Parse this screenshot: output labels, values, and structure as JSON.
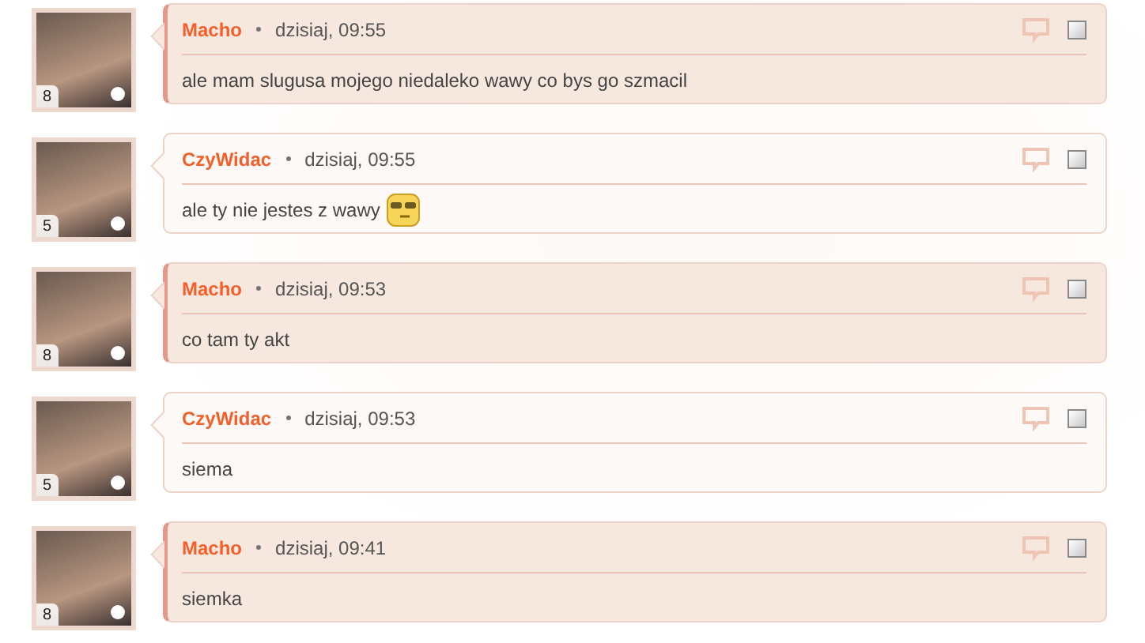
{
  "messages": [
    {
      "author": "Macho",
      "rank": "8",
      "time": "dzisiaj, 09:55",
      "text": "ale mam slugusa mojego niedaleko wawy co bys go szmacil",
      "highlighted": true,
      "emoji": false,
      "checked": false
    },
    {
      "author": "CzyWidac",
      "rank": "5",
      "time": "dzisiaj, 09:55",
      "text": "ale ty nie jestes z wawy",
      "highlighted": false,
      "emoji": true,
      "checked": false
    },
    {
      "author": "Macho",
      "rank": "8",
      "time": "dzisiaj, 09:53",
      "text": "co tam ty akt",
      "highlighted": true,
      "emoji": false,
      "checked": false
    },
    {
      "author": "CzyWidac",
      "rank": "5",
      "time": "dzisiaj, 09:53",
      "text": "siema",
      "highlighted": false,
      "emoji": false,
      "checked": false
    },
    {
      "author": "Macho",
      "rank": "8",
      "time": "dzisiaj, 09:41",
      "text": "siemka",
      "highlighted": true,
      "emoji": false,
      "checked": false
    }
  ]
}
